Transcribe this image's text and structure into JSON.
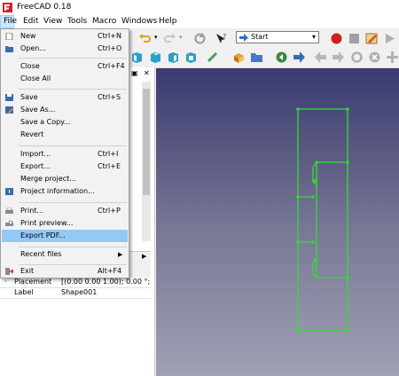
{
  "app": {
    "title": "FreeCAD 0.18"
  },
  "menubar": [
    "File",
    "Edit",
    "View",
    "Tools",
    "Macro",
    "Windows",
    "Help"
  ],
  "workbench": {
    "selected": "Start"
  },
  "file_menu": [
    {
      "label": "New",
      "shortcut": "Ctrl+N"
    },
    {
      "label": "Open...",
      "shortcut": "Ctrl+O"
    },
    {
      "label": "Close",
      "shortcut": "Ctrl+F4"
    },
    {
      "label": "Close All",
      "shortcut": ""
    },
    {
      "label": "Save",
      "shortcut": "Ctrl+S"
    },
    {
      "label": "Save As...",
      "shortcut": ""
    },
    {
      "label": "Save a Copy...",
      "shortcut": ""
    },
    {
      "label": "Revert",
      "shortcut": ""
    },
    {
      "label": "Import...",
      "shortcut": "Ctrl+I"
    },
    {
      "label": "Export...",
      "shortcut": "Ctrl+E"
    },
    {
      "label": "Merge project...",
      "shortcut": ""
    },
    {
      "label": "Project information...",
      "shortcut": ""
    },
    {
      "label": "Print...",
      "shortcut": "Ctrl+P"
    },
    {
      "label": "Print preview...",
      "shortcut": ""
    },
    {
      "label": "Export PDF...",
      "shortcut": "",
      "highlighted": true
    },
    {
      "label": "Recent files",
      "shortcut": ""
    },
    {
      "label": "Exit",
      "shortcut": "Alt+F4"
    }
  ],
  "properties": [
    {
      "key": "Placement",
      "value": "[(0.00 0.00 1.00); 0.00 °; (0...."
    },
    {
      "key": "Label",
      "value": "Shape001"
    }
  ],
  "colors": {
    "menu_highlight": "#91c9f7",
    "sketch_line": "#33dd33",
    "record": "#cc2222"
  }
}
